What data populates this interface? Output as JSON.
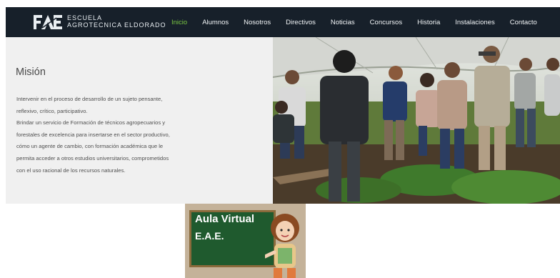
{
  "brand": {
    "line1": "ESCUELA",
    "line2": "AGROTECNICA ELDORADO"
  },
  "nav": {
    "items": [
      {
        "label": "Inicio",
        "active": true
      },
      {
        "label": "Alumnos",
        "active": false
      },
      {
        "label": "Nosotros",
        "active": false
      },
      {
        "label": "Directivos",
        "active": false
      },
      {
        "label": "Noticias",
        "active": false
      },
      {
        "label": "Concursos",
        "active": false
      },
      {
        "label": "Historia",
        "active": false
      },
      {
        "label": "Instalaciones",
        "active": false
      },
      {
        "label": "Contacto",
        "active": false
      }
    ]
  },
  "mission": {
    "title": "Misión",
    "lines": [
      "Intervenir en el proceso de desarrollo de un sujeto pensante,",
      "reflexivo, crítico, participativo.",
      "Brindar un servicio de Formación de técnicos agropecuarios y",
      "forestales de excelencia para insertarse en el sector productivo,",
      "cómo un agente de cambio, con formación académica que le",
      "permita acceder a otros estudios universitarios, comprometidos",
      "con el uso racional de los recursos naturales."
    ]
  },
  "aula": {
    "line1": "Aula Virtual",
    "line2": "E.A.E."
  },
  "colors": {
    "nav_bg": "#17202a",
    "active": "#79c542",
    "panel_bg": "#f0f0f0",
    "board": "#1f5a2e"
  }
}
